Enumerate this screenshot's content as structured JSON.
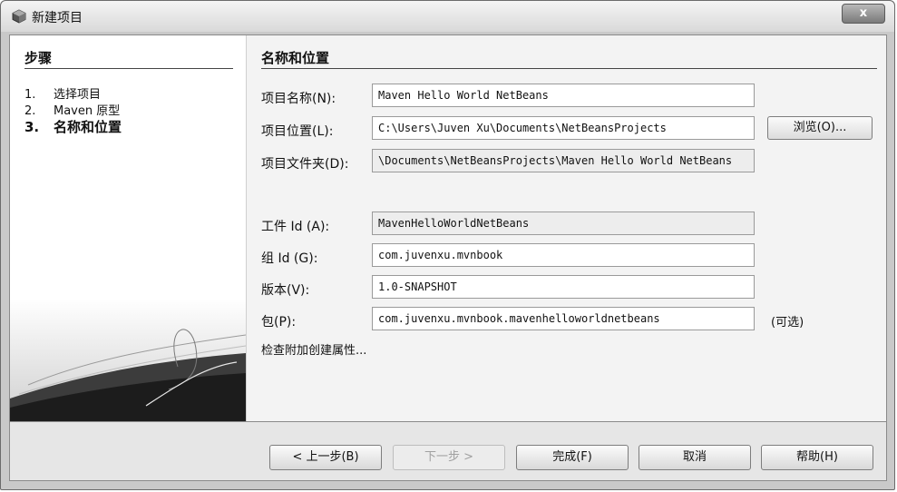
{
  "window": {
    "title": "新建项目",
    "close_label": "x"
  },
  "steps": {
    "heading": "步骤",
    "items": [
      {
        "num": "1.",
        "label": "选择项目"
      },
      {
        "num": "2.",
        "label": "Maven 原型"
      },
      {
        "num": "3.",
        "label": "名称和位置"
      }
    ]
  },
  "form": {
    "heading": "名称和位置",
    "project_name": {
      "label": "项目名称(N):",
      "value": "Maven Hello World NetBeans"
    },
    "project_location": {
      "label": "项目位置(L):",
      "value": "C:\\Users\\Juven Xu\\Documents\\NetBeansProjects"
    },
    "browse_label": "浏览(O)...",
    "project_folder": {
      "label": "项目文件夹(D):",
      "value": "\\Documents\\NetBeansProjects\\Maven Hello World NetBeans"
    },
    "artifact_id": {
      "label": "工件 Id (A):",
      "value": "MavenHelloWorldNetBeans"
    },
    "group_id": {
      "label": "组 Id (G):",
      "value": "com.juvenxu.mvnbook"
    },
    "version": {
      "label": "版本(V):",
      "value": "1.0-SNAPSHOT"
    },
    "package": {
      "label": "包(P):",
      "value": "com.juvenxu.mvnbook.mavenhelloworldnetbeans"
    },
    "optional_note": "(可选)",
    "additional_link": "检查附加创建属性..."
  },
  "footer": {
    "back_label": "< 上一步(B)",
    "next_label": "下一步 >",
    "finish_label": "完成(F)",
    "cancel_label": "取消",
    "help_label": "帮助(H)"
  },
  "icons": {
    "app": "netbeans-cube-icon"
  }
}
